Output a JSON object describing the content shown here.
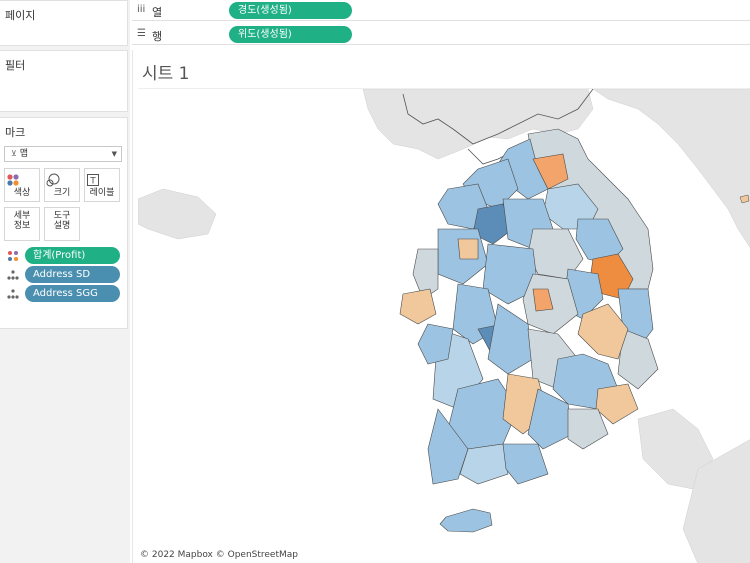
{
  "panels": {
    "pages_title": "페이지",
    "filters_title": "필터",
    "marks_title": "마크"
  },
  "marks": {
    "type": "맵",
    "buttons": {
      "color": "색상",
      "size": "크기",
      "label": "레이블",
      "detail_1": "세부",
      "detail_2": "정보",
      "tooltip_1": "도구",
      "tooltip_2": "설명"
    },
    "fields": [
      {
        "label": "합계(Profit)",
        "color": "#1fb085"
      },
      {
        "label": "Address SD",
        "color": "#4a8fb0"
      },
      {
        "label": "Address SGG",
        "color": "#4a8fb0"
      }
    ]
  },
  "shelves": {
    "columns_label": "열",
    "columns_pill": "경도(생성됨)",
    "rows_label": "행",
    "rows_pill": "위도(생성됨)"
  },
  "sheet": {
    "title": "시트 1",
    "attribution": "© 2022 Mapbox © OpenStreetMap"
  },
  "colors": {
    "positive_dark": "#5b8db8",
    "positive": "#9cc3e1",
    "neutral": "#cfd8dd",
    "negative": "#f0c89c",
    "negative_dark": "#ee8c3f",
    "basemap_land": "#e4e4e4"
  }
}
